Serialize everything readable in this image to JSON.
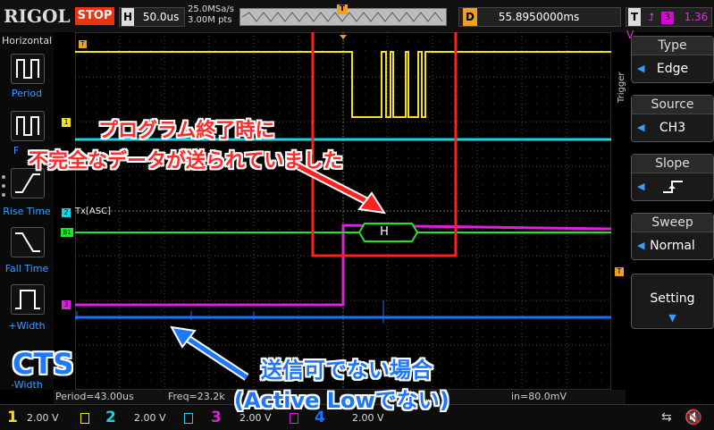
{
  "header": {
    "brand": "RIGOL",
    "run_state": "STOP",
    "timebase_key": "H",
    "timebase": "50.0us",
    "sample_rate": "25.0MSa/s",
    "memory_depth": "3.00M pts",
    "delay_key": "D",
    "delay": "55.8950000ms",
    "trigger_key": "T",
    "trigger_source_badge": "3",
    "trigger_level": "1.36 V",
    "trigger_marker": "T"
  },
  "left_menu": {
    "title": "Horizontal",
    "items": [
      "Period",
      "F",
      "Rise Time",
      "Fall Time",
      "+Width",
      "-Width"
    ]
  },
  "right_panel": {
    "side_label": "Trigger",
    "type": {
      "header": "Type",
      "value": "Edge"
    },
    "source": {
      "header": "Source",
      "value": "CH3"
    },
    "slope": {
      "header": "Slope",
      "value": ""
    },
    "sweep": {
      "header": "Sweep",
      "value": "Normal"
    },
    "setting": {
      "header": "Setting"
    }
  },
  "screen": {
    "ch1_marker": "1",
    "ch2_marker": "2",
    "ch2_decode_label": "Tx[ASC]",
    "b1_marker": "B1",
    "ch3_marker": "3",
    "decode_value": "H",
    "trigger_level_marker": "T"
  },
  "measurements": {
    "period": "Period=43.00us",
    "freq": "Freq=23.2k",
    "vmin": "in=80.0mV"
  },
  "channels": [
    {
      "num": "1",
      "scale": "2.00 V",
      "color": "#f5e11a"
    },
    {
      "num": "2",
      "scale": "2.00 V",
      "color": "#19d4e6"
    },
    {
      "num": "3",
      "scale": "2.00 V",
      "color": "#e020e0"
    },
    {
      "num": "4",
      "scale": "2.00 V",
      "color": "#1e6fff"
    }
  ],
  "annotations": {
    "red_line1": "プログラム終了時に",
    "red_line2": "不完全なデータが送られていました",
    "cts": "CTS",
    "blue_line1": "送信可でない場合",
    "blue_line2": "(Active Lowでない)"
  },
  "colors": {
    "ch1": "#f5e11a",
    "ch2": "#19d4e6",
    "ch3": "#e020e0",
    "ch4": "#1e6fff",
    "decode": "#2adf2a",
    "highlight": "#ff2020",
    "accent": "#3a9cff"
  }
}
